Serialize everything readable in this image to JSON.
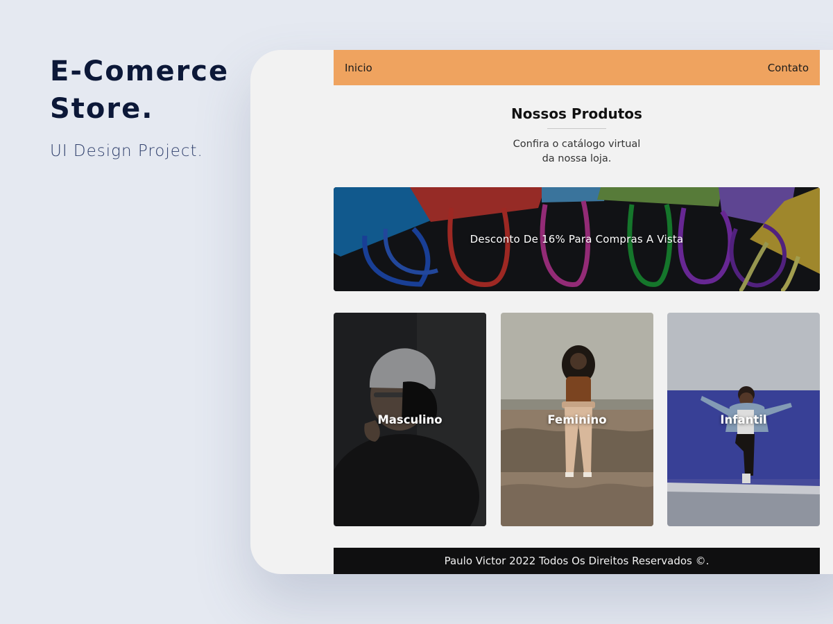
{
  "project": {
    "title_line1": "E-Comerce",
    "title_line2": "Store.",
    "subtitle": "UI Design Project."
  },
  "nav": {
    "home": "Inicio",
    "contact": "Contato"
  },
  "products_section": {
    "title": "Nossos Produtos",
    "description_line1": "Confira o catálogo virtual",
    "description_line2": "da nossa loja."
  },
  "banner": {
    "text": "Desconto De 16% Para Compras A Vista"
  },
  "categories": [
    {
      "label": "Masculino"
    },
    {
      "label": "Feminino"
    },
    {
      "label": "Infantil"
    }
  ],
  "footer": {
    "text": "Paulo Victor 2022 Todos Os Direitos Reservados ©."
  },
  "colors": {
    "page_background": "#e5e9f1",
    "title_navy": "#0c1838",
    "navbar_orange": "#efa35f",
    "content_background": "#f2f2f2",
    "footer_black": "#0f0f10"
  }
}
